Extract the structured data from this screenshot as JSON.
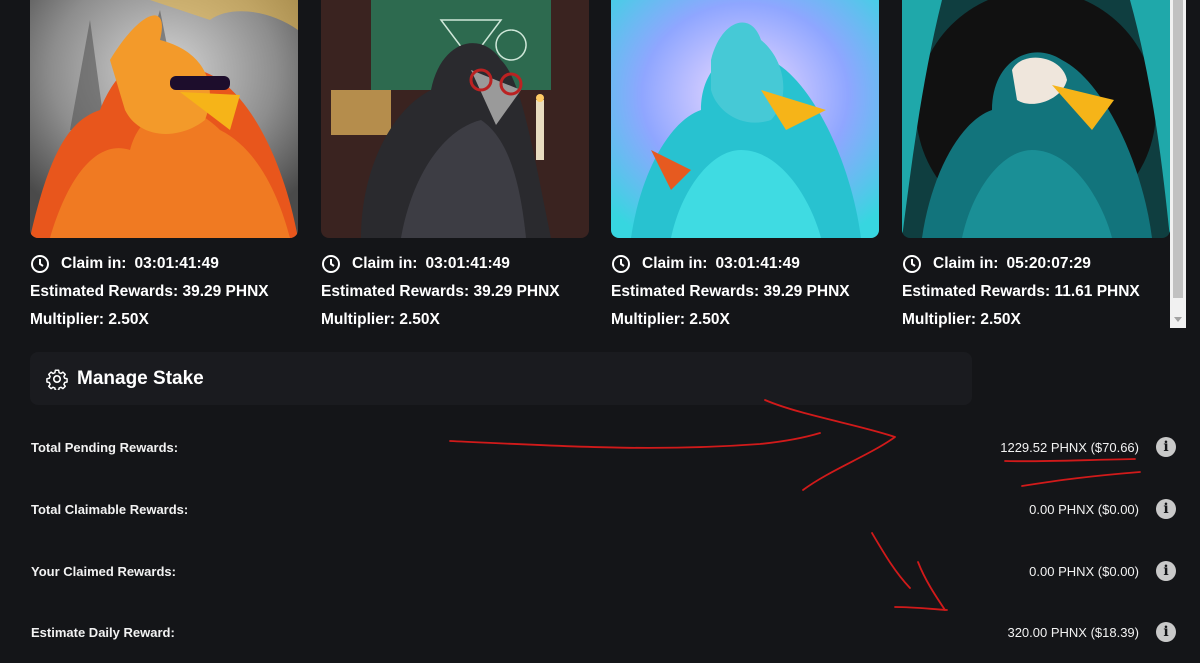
{
  "cards": [
    {
      "claim_label": "Claim in:",
      "claim_time": "03:01:41:49",
      "rewards": "Estimated Rewards: 39.29 PHNX",
      "multiplier": "Multiplier: 2.50X"
    },
    {
      "claim_label": "Claim in:",
      "claim_time": "03:01:41:49",
      "rewards": "Estimated Rewards: 39.29 PHNX",
      "multiplier": "Multiplier: 2.50X"
    },
    {
      "claim_label": "Claim in:",
      "claim_time": "03:01:41:49",
      "rewards": "Estimated Rewards: 39.29 PHNX",
      "multiplier": "Multiplier: 2.50X"
    },
    {
      "claim_label": "Claim in:",
      "claim_time": "05:20:07:29",
      "rewards": "Estimated Rewards: 11.61 PHNX",
      "multiplier": "Multiplier: 2.50X"
    }
  ],
  "manage": {
    "title": "Manage Stake",
    "icon": "gear-icon"
  },
  "rewards": [
    {
      "label": "Total Pending Rewards:",
      "value": "1229.52 PHNX ($70.66)"
    },
    {
      "label": "Total Claimable Rewards:",
      "value": "0.00 PHNX ($0.00)"
    },
    {
      "label": "Your Claimed Rewards:",
      "value": "0.00 PHNX ($0.00)"
    },
    {
      "label": "Estimate Daily Reward:",
      "value": "320.00 PHNX ($18.39)"
    }
  ],
  "info_glyph": "i",
  "colors": {
    "background": "#141518",
    "panel": "#1a1b1f",
    "annotation": "#d11a1a"
  }
}
